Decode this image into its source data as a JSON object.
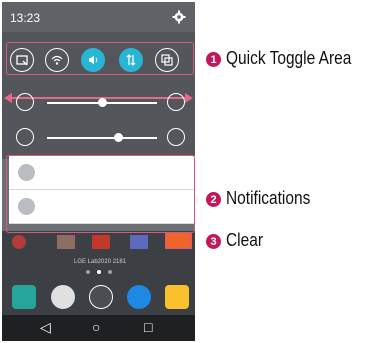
{
  "status_bar": {
    "time": "13:23",
    "settings_icon": "gear-icon"
  },
  "quick_toggles": [
    {
      "name": "screen-capture-icon",
      "active": false
    },
    {
      "name": "wifi-icon",
      "active": false
    },
    {
      "name": "sound-icon",
      "active": true
    },
    {
      "name": "data-sync-icon",
      "active": true
    },
    {
      "name": "multi-window-icon",
      "active": false
    }
  ],
  "sliders": [
    {
      "name": "brightness",
      "icon": "brightness-icon",
      "end_icon": "check-circle-icon",
      "level": 0.5
    },
    {
      "name": "volume",
      "icon": "ringtone-volume-icon",
      "end_icon": "gear-icon",
      "level": 0.65
    }
  ],
  "notifications": [
    {
      "icon": "check-icon"
    },
    {
      "icon": "usb-icon"
    }
  ],
  "home_screen": {
    "carrier_text": "LGE Lab2020 2181"
  },
  "navigation": {
    "back": "◁",
    "home": "○",
    "recents": "□"
  },
  "callouts": [
    {
      "number": "1",
      "label": "Quick Toggle Area"
    },
    {
      "number": "2",
      "label": "Notifications"
    },
    {
      "number": "3",
      "label": "Clear"
    }
  ],
  "colors": {
    "accent_toggle": "#29b6d6",
    "callout": "#c2185b",
    "highlight_border": "#d35b83",
    "clear_button": "#f0632a"
  }
}
